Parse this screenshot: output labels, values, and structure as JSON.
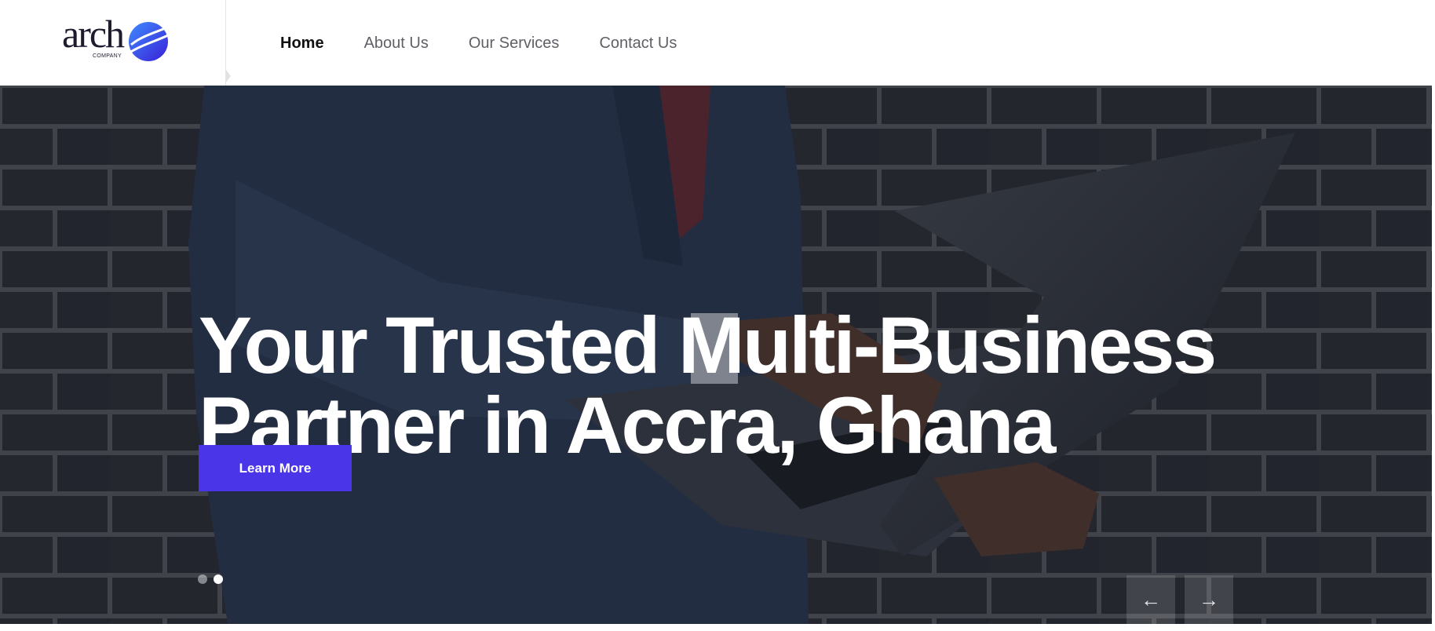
{
  "brand": {
    "wordmark": "arch",
    "tagline": "COMPANY",
    "accent_color": "#4a35e8"
  },
  "nav": {
    "items": [
      {
        "label": "Home",
        "active": true
      },
      {
        "label": "About Us",
        "active": false
      },
      {
        "label": "Our Services",
        "active": false
      },
      {
        "label": "Contact Us",
        "active": false
      }
    ]
  },
  "hero": {
    "title_line1": "Your Trusted Multi-Business",
    "title_line2": "Partner in Accra, Ghana",
    "cta_label": "Learn More",
    "slides": {
      "count": 2,
      "active_index": 1
    },
    "prev_icon": "arrow-left-icon",
    "next_icon": "arrow-right-icon",
    "prev_glyph": "←",
    "next_glyph": "→"
  }
}
